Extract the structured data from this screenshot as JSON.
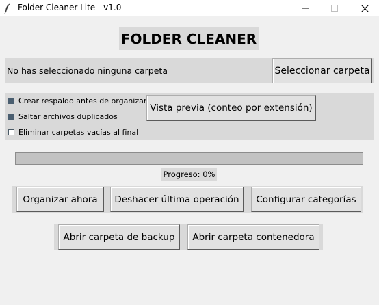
{
  "window": {
    "title": "Folder Cleaner Lite - v1.0",
    "icon": "feather-icon",
    "controls": {
      "minimize": "minimize-icon",
      "maximize": "maximize-icon",
      "close": "close-icon"
    }
  },
  "header": {
    "title": "FOLDER CLEANER"
  },
  "folder": {
    "status_text": "No has seleccionado ninguna carpeta",
    "select_button": "Seleccionar carpeta"
  },
  "options": [
    {
      "label": "Crear respaldo antes de organizar",
      "checked": true
    },
    {
      "label": "Saltar archivos duplicados",
      "checked": true
    },
    {
      "label": "Eliminar carpetas vacías al final",
      "checked": false
    }
  ],
  "preview_button": "Vista previa (conteo por extensión)",
  "progress": {
    "label": "Progreso: 0%",
    "value": 0
  },
  "actions": {
    "organize": "Organizar ahora",
    "undo": "Deshacer última operación",
    "categories": "Configurar categorías",
    "open_backup": "Abrir carpeta de backup",
    "open_container": "Abrir carpeta contenedora"
  },
  "colors": {
    "window_bg": "#f0f0f0",
    "frame_bg": "#d9d9d9",
    "checkbox_checked": "#4a5e70",
    "progress_trough": "#c2c2c2"
  }
}
